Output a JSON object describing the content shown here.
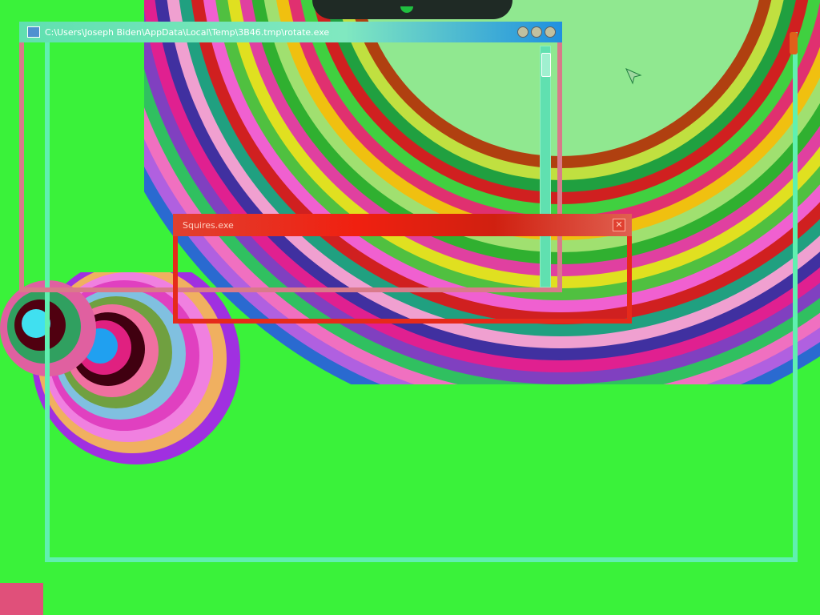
{
  "desktop": {
    "background_color": "#3af23a"
  },
  "windows": {
    "rotate": {
      "title": "C:\\Users\\Joseph Biden\\AppData\\Local\\Temp\\3B46.tmp\\rotate.exe",
      "frame_color": "#d97a8a",
      "title_color": "#ffffff",
      "icon": "app-icon",
      "buttons": [
        "minimize-icon",
        "maximize-icon",
        "close-icon"
      ]
    },
    "squires": {
      "title": "Squires.exe",
      "frame_color": "#e62a1a",
      "title_color": "#ffd0c0",
      "buttons": [
        "close-icon"
      ]
    },
    "outer": {
      "frame_color": "#60f0b0"
    }
  },
  "top_dock": {
    "icon": "dock-icon"
  },
  "taskbar": {
    "start_color": "#e0507a"
  },
  "cursor": {
    "icon": "mouse-cursor-icon"
  }
}
